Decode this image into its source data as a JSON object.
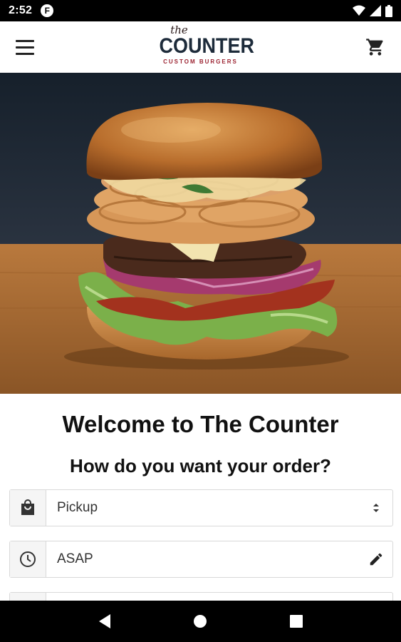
{
  "status_bar": {
    "time": "2:52",
    "app_icon_letter": "F",
    "icons": [
      "wifi-icon",
      "signal-icon",
      "battery-icon"
    ]
  },
  "header": {
    "logo": {
      "the": "the",
      "name": "COUNTER",
      "tagline": "CUSTOM BURGERS"
    },
    "menu_icon": "menu-icon",
    "cart_icon": "cart-icon"
  },
  "hero": {
    "image": "burger-photo"
  },
  "main": {
    "title": "Welcome to The Counter",
    "subtitle": "How do you want your order?",
    "order_type": {
      "icon": "shopping-bag-icon",
      "value": "Pickup",
      "trailing_icon": "select-arrows-icon"
    },
    "order_time": {
      "icon": "clock-icon",
      "value": "ASAP",
      "trailing_icon": "pencil-icon"
    }
  },
  "colors": {
    "logo_navy": "#1d2b3a",
    "logo_red": "#9b2230",
    "background_dark": "#1a2430"
  },
  "nav_bar": {
    "buttons": [
      "back-icon",
      "home-icon",
      "recents-icon"
    ]
  }
}
